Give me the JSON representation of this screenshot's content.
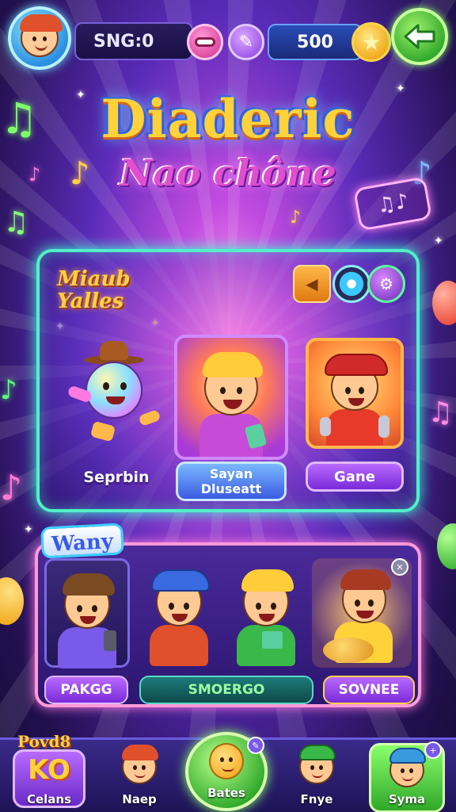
{
  "top_bar": {
    "score_text": "SNG:0",
    "coins_value": "500",
    "star_glyph": "★",
    "back_glyph": "⇐"
  },
  "title": {
    "main": "Diaderic",
    "sub": "Nao chône"
  },
  "deco_sign": "♫♪",
  "featured_panel": {
    "heading": "Miaub Yalles",
    "characters": [
      {
        "label": "Seprbin"
      },
      {
        "label": "Sayan Dluseatt"
      },
      {
        "label": "Gane"
      }
    ]
  },
  "roster_panel": {
    "heading": "Wany",
    "buttons": [
      "PAKGG",
      "SMOERGO",
      "SOVNEE"
    ]
  },
  "bottom_nav": {
    "items": [
      {
        "label": "Celans",
        "badge": "Povd8",
        "center": "KO"
      },
      {
        "label": "Naep"
      },
      {
        "label": "Bates"
      },
      {
        "label": "Fnye"
      },
      {
        "label": "Syma"
      }
    ]
  },
  "colors": {
    "accent_green": "#52f0c8",
    "accent_pink": "#ff9ad8",
    "coin_blue": "#2a4cb8",
    "button_purple": "#8a3ae0",
    "button_teal": "#1e6a6a"
  },
  "icons": [
    "avatar-icon",
    "lips-icon",
    "feather-icon",
    "star-icon",
    "back-arrow-icon",
    "arrow-left-icon",
    "disc-icon",
    "gear-icon",
    "music-note-icon",
    "plus-badge-icon"
  ]
}
